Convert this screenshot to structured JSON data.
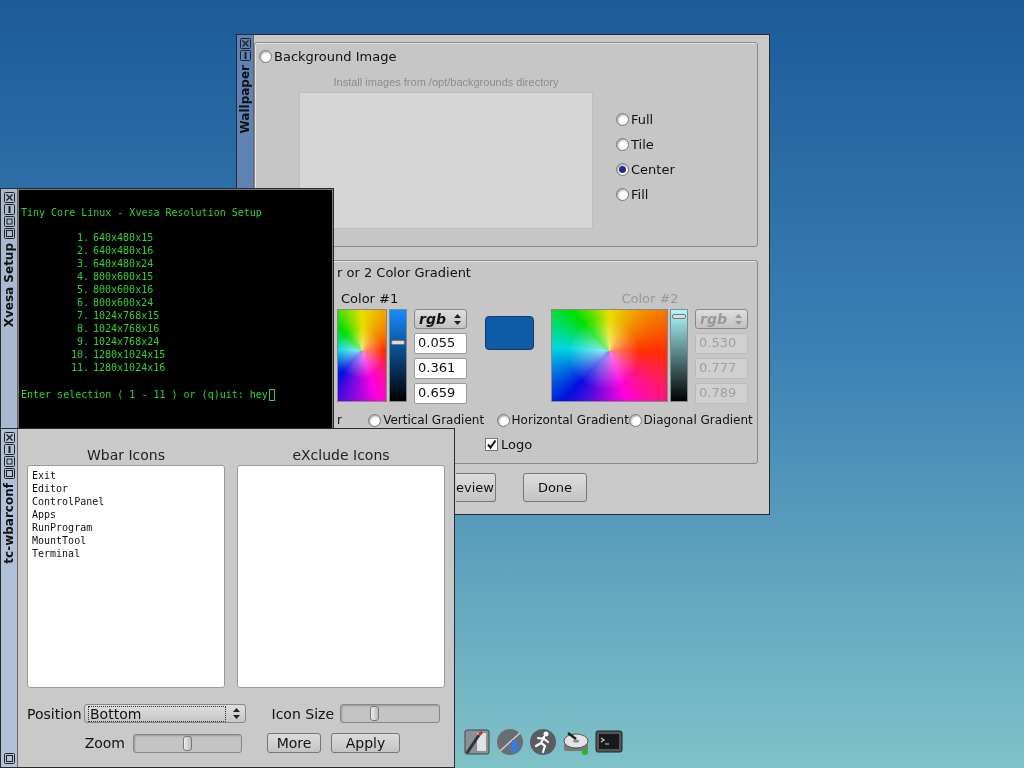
{
  "wallpaper_window": {
    "title": "Wallpaper",
    "background_image": {
      "label": "Background Image",
      "selected": false
    },
    "image_hint": "Install images from /opt/backgrounds directory",
    "placements": [
      {
        "label": "Full",
        "selected": false
      },
      {
        "label": "Tile",
        "selected": false
      },
      {
        "label": "Center",
        "selected": true
      },
      {
        "label": "Fill",
        "selected": false
      }
    ],
    "gradient_group": {
      "title": "r or 2 Color Gradient",
      "colors": [
        {
          "label": "Color #1",
          "mode": "rgb",
          "disabled": false,
          "level": 0.65,
          "values": [
            "0.055",
            "0.361",
            "0.659"
          ]
        },
        {
          "label": "Color #2",
          "mode": "rgb",
          "disabled": true,
          "level": 0.93,
          "values": [
            "0.530",
            "0.777",
            "0.789"
          ]
        }
      ],
      "cut_option": "r",
      "gradient_types": [
        {
          "label": "Vertical Gradient",
          "selected": false
        },
        {
          "label": "Horizontal Gradient",
          "selected": false
        },
        {
          "label": "Diagonal Gradient",
          "selected": false
        }
      ],
      "logo": {
        "label": "Logo",
        "checked": true
      }
    },
    "buttons": [
      "eview",
      "Done"
    ]
  },
  "xvesa_window": {
    "title": "Xvesa Setup",
    "heading": "Tiny Core Linux - Xvesa Resolution Setup",
    "options": [
      {
        "number": "1.",
        "mode": "640x480x15"
      },
      {
        "number": "2.",
        "mode": "640x480x16"
      },
      {
        "number": "3.",
        "mode": "640x480x24"
      },
      {
        "number": "4.",
        "mode": "800x600x15"
      },
      {
        "number": "5.",
        "mode": "800x600x16"
      },
      {
        "number": "6.",
        "mode": "800x600x24"
      },
      {
        "number": "7.",
        "mode": "1024x768x15"
      },
      {
        "number": "8.",
        "mode": "1024x768x16"
      },
      {
        "number": "9.",
        "mode": "1024x768x24"
      },
      {
        "number": "10.",
        "mode": "1280x1024x15"
      },
      {
        "number": "11.",
        "mode": "1280x1024x16"
      }
    ],
    "prompt": "Enter selection ( 1 - 11 ) or (q)uit: hey"
  },
  "wbarconf_window": {
    "title": "tc-wbarconf",
    "wbar_icons": {
      "heading": "Wbar Icons",
      "items": [
        {
          "label": "Exit",
          "selected": false
        },
        {
          "label": "Editor",
          "selected": false
        },
        {
          "label": "ControlPanel",
          "selected": false
        },
        {
          "label": "Apps",
          "selected": false
        },
        {
          "label": "RunProgram",
          "selected": false
        },
        {
          "label": "MountTool",
          "selected": false
        },
        {
          "label": "Terminal",
          "selected": false
        }
      ]
    },
    "exclude_icons": {
      "heading": "eXclude Icons"
    },
    "position": {
      "label": "Position",
      "value": "Bottom"
    },
    "icon_size": {
      "label": "Icon Size",
      "level": 0.31
    },
    "zoom": {
      "label": "Zoom",
      "level": 0.5
    },
    "buttons": [
      "More",
      "Apply"
    ]
  }
}
